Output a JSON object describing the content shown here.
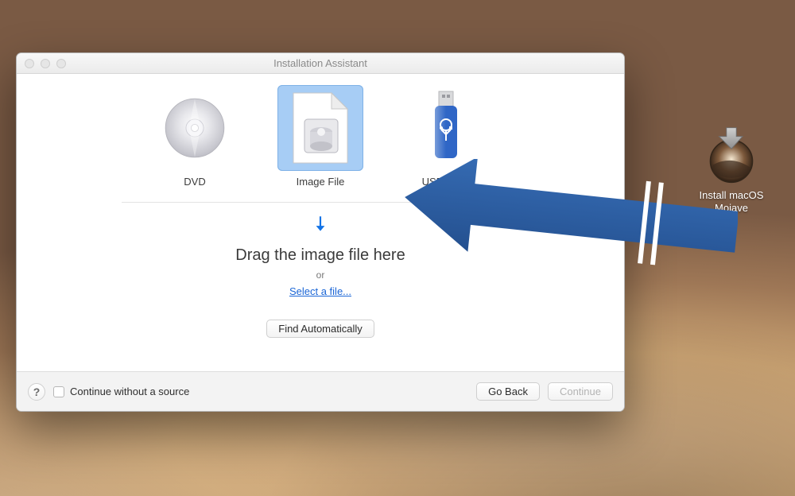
{
  "window": {
    "title": "Installation Assistant",
    "options": [
      {
        "label": "DVD"
      },
      {
        "label": "Image File"
      },
      {
        "label": "USB Drive"
      }
    ],
    "dropzone": {
      "heading": "Drag the image file here",
      "or": "or",
      "select_link": "Select a file..."
    },
    "find_button": "Find Automatically",
    "footer": {
      "help": "?",
      "checkbox_label": "Continue without a source",
      "go_back": "Go Back",
      "continue": "Continue"
    }
  },
  "desktop_icon": {
    "label_line1": "Install macOS",
    "label_line2": "Mojave"
  },
  "colors": {
    "accent": "#1373e6",
    "annotation_arrow": "#2c5aa0"
  }
}
